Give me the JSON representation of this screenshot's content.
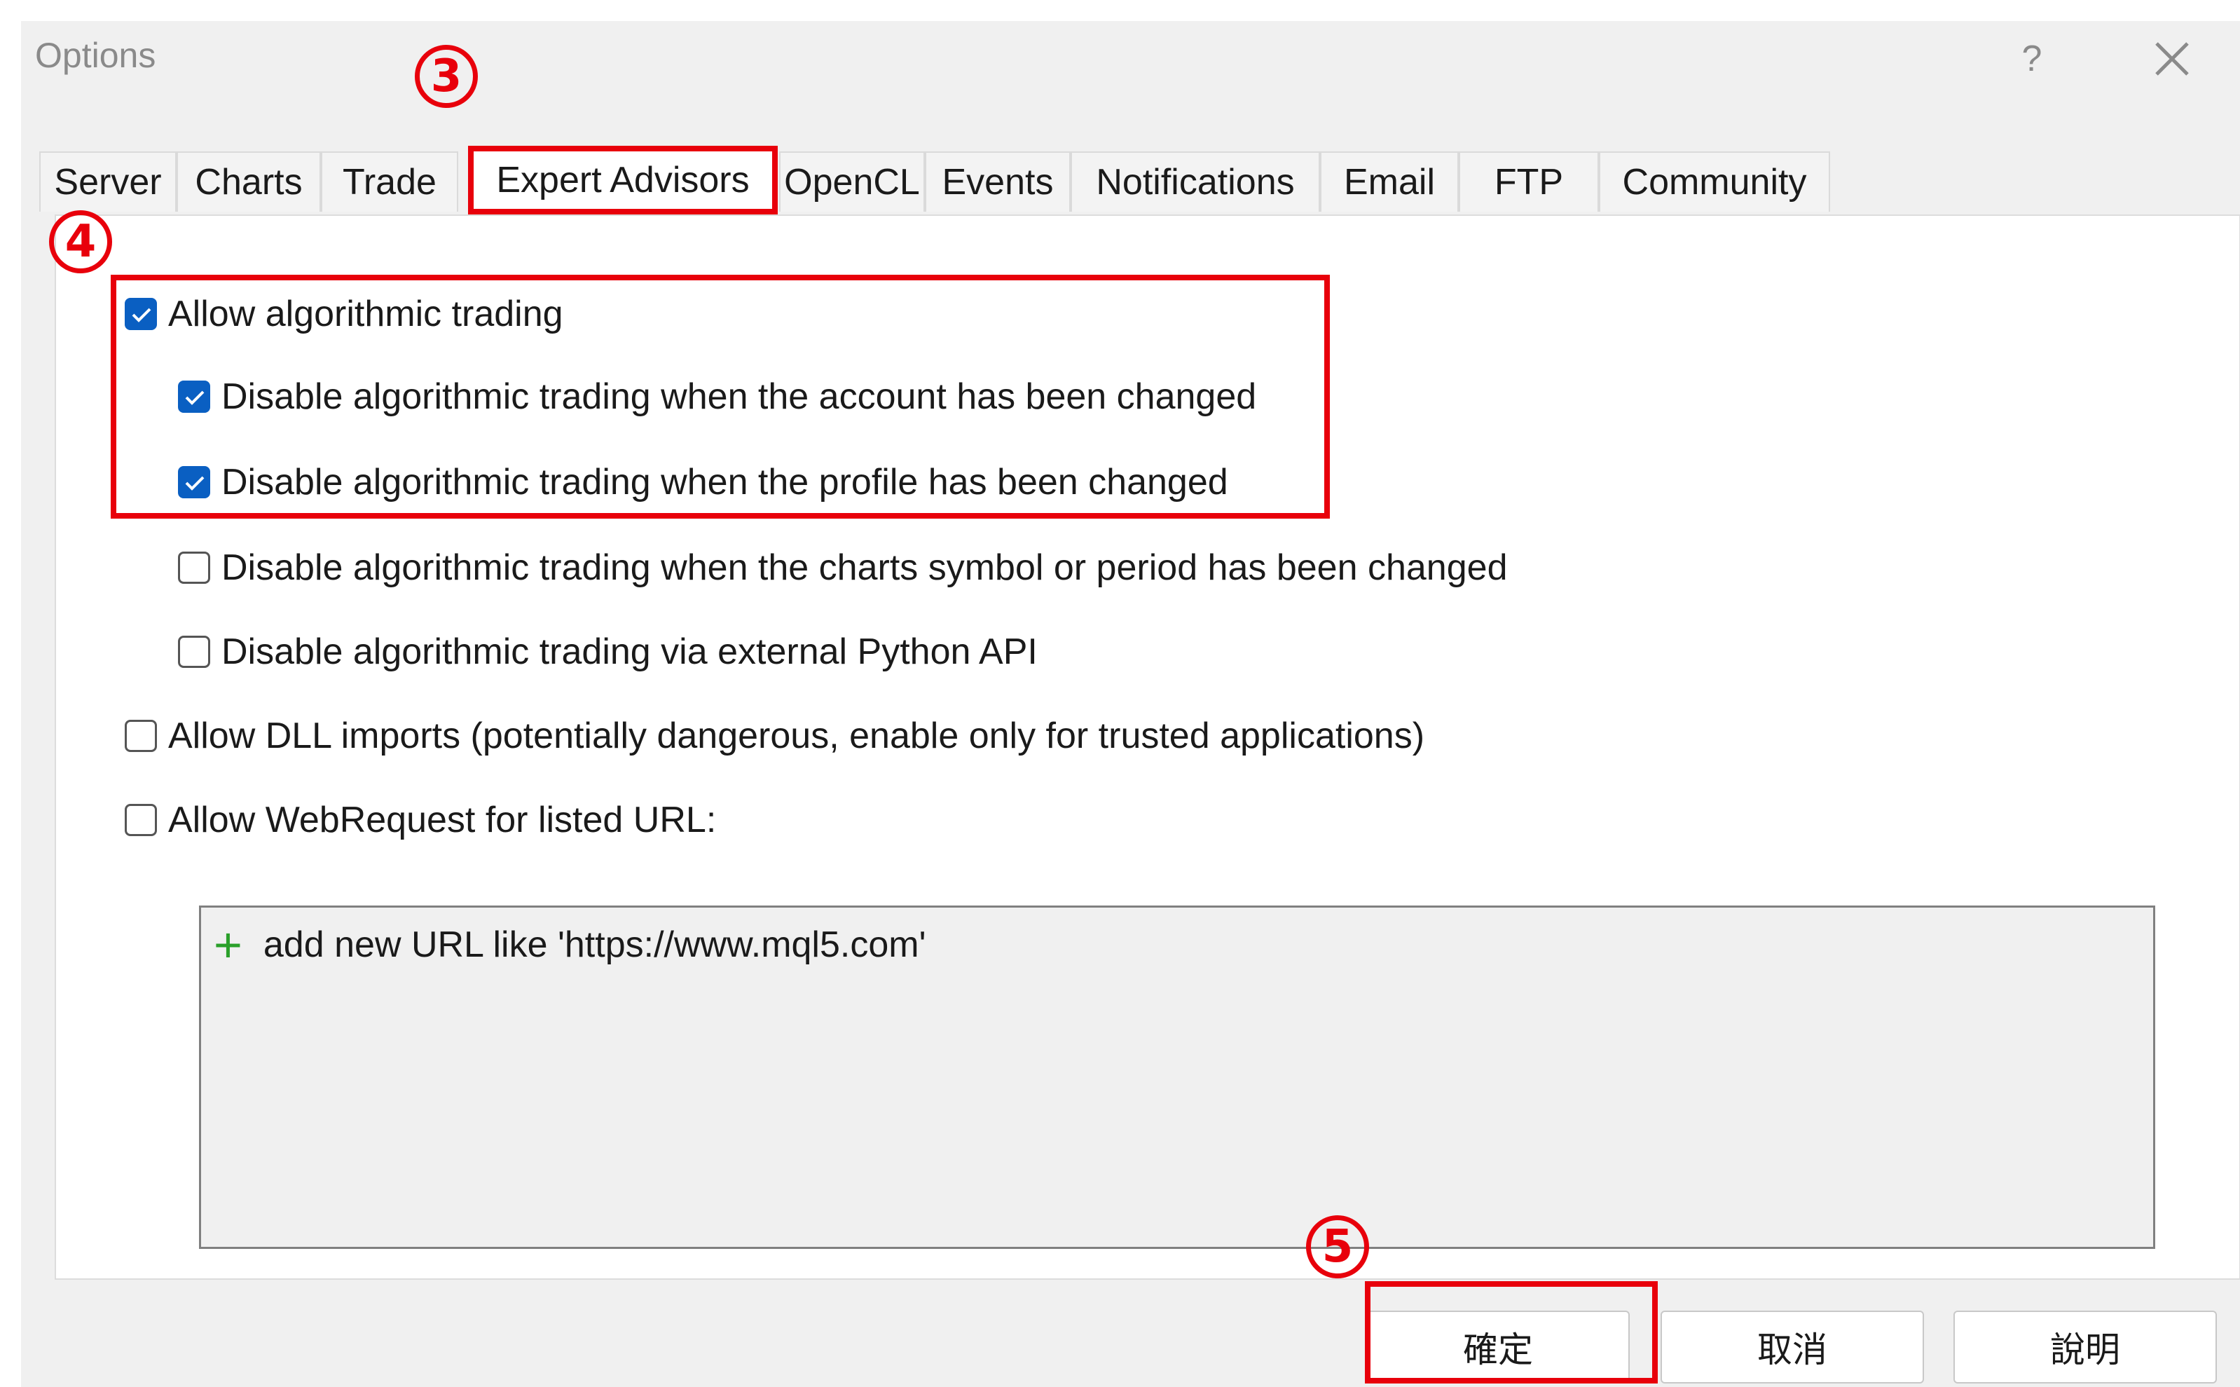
{
  "window": {
    "title": "Options",
    "help_label": "?"
  },
  "tabs": [
    {
      "label": "Server"
    },
    {
      "label": "Charts"
    },
    {
      "label": "Trade"
    },
    {
      "label": "Expert Advisors",
      "active": true
    },
    {
      "label": "OpenCL"
    },
    {
      "label": "Events"
    },
    {
      "label": "Notifications"
    },
    {
      "label": "Email"
    },
    {
      "label": "FTP"
    },
    {
      "label": "Community"
    }
  ],
  "options": [
    {
      "label": "Allow algorithmic trading",
      "checked": true
    },
    {
      "label": "Disable algorithmic trading when the account has been changed",
      "checked": true
    },
    {
      "label": "Disable algorithmic trading when the profile has been changed",
      "checked": true
    },
    {
      "label": "Disable algorithmic trading when the charts symbol or period has been changed",
      "checked": false
    },
    {
      "label": "Disable algorithmic trading via external Python API",
      "checked": false
    },
    {
      "label": "Allow DLL imports (potentially dangerous, enable only for trusted applications)",
      "checked": false
    },
    {
      "label": "Allow WebRequest for listed URL:",
      "checked": false
    }
  ],
  "url_list": {
    "add_label": "add new URL like 'https://www.mql5.com'"
  },
  "buttons": {
    "ok": "確定",
    "cancel": "取消",
    "help": "說明"
  },
  "annotations": {
    "step3": "3",
    "step4": "4",
    "step5": "5"
  },
  "colors": {
    "highlight": "#e8000b",
    "checkbox_checked": "#0a5fc2",
    "plus_icon": "#2aa02a"
  }
}
